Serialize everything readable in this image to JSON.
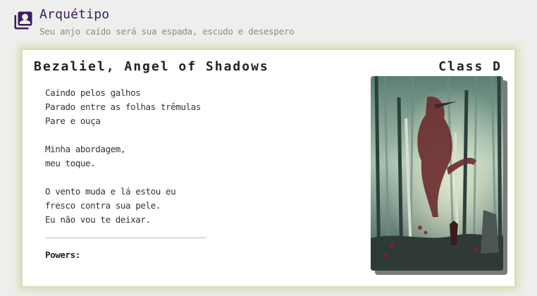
{
  "header": {
    "title": "Arquétipo",
    "subtitle": "Seu anjo caído será sua espada, escudo e desespero",
    "icon": "portrait-card-icon",
    "accent_color": "#3b1b5f"
  },
  "card": {
    "title": "Bezaliel, Angel of Shadows",
    "class_label": "Class D",
    "poem": [
      [
        "Caindo pelos galhos",
        "Parado entre as folhas trêmulas",
        "Pare e ouça"
      ],
      [
        "Minha abordagem,",
        "meu toque."
      ],
      [
        "O vento muda e lá estou eu",
        "fresco contra sua pele.",
        "Eu não vou te deixar."
      ]
    ],
    "powers_label": "Powers:",
    "image_alt": "forest-angel-artwork"
  }
}
